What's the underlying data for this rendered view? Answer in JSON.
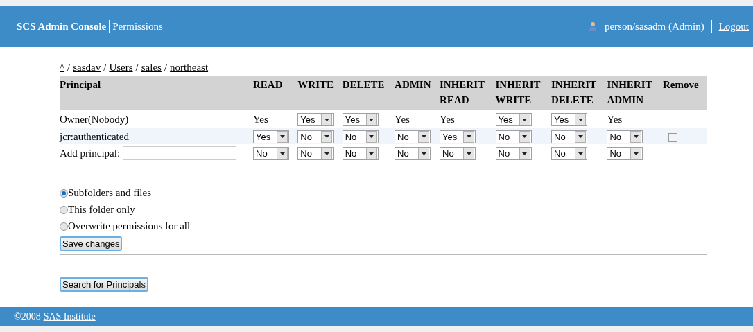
{
  "header": {
    "title": "SCS Admin Console",
    "section": "Permissions",
    "user": "person/sasadm (Admin)",
    "logout": "Logout"
  },
  "breadcrumb": [
    {
      "kind": "link",
      "text": "^"
    },
    {
      "kind": "separator",
      "text": "/"
    },
    {
      "kind": "link",
      "text": "sasdav"
    },
    {
      "kind": "separator",
      "text": "/"
    },
    {
      "kind": "link",
      "text": "Users"
    },
    {
      "kind": "separator",
      "text": "/"
    },
    {
      "kind": "link",
      "text": "sales"
    },
    {
      "kind": "separator",
      "text": "/"
    },
    {
      "kind": "link",
      "text": "northeast"
    }
  ],
  "table": {
    "columns": [
      {
        "lines": [
          "Principal"
        ]
      },
      {
        "lines": [
          "READ"
        ]
      },
      {
        "lines": [
          "WRITE"
        ]
      },
      {
        "lines": [
          "DELETE"
        ]
      },
      {
        "lines": [
          "ADMIN"
        ]
      },
      {
        "lines": [
          "INHERIT",
          "READ"
        ]
      },
      {
        "lines": [
          "INHERIT",
          "WRITE"
        ]
      },
      {
        "lines": [
          "INHERIT",
          "DELETE"
        ]
      },
      {
        "lines": [
          "INHERIT",
          "ADMIN"
        ]
      },
      {
        "lines": [
          "Remove"
        ]
      }
    ],
    "rows": [
      {
        "cells": [
          {
            "kind": "principal",
            "value": "Owner(Nobody)"
          },
          {
            "kind": "text",
            "value": "Yes"
          },
          {
            "kind": "select",
            "value": "Yes"
          },
          {
            "kind": "select",
            "value": "Yes"
          },
          {
            "kind": "text",
            "value": "Yes"
          },
          {
            "kind": "text",
            "value": "Yes"
          },
          {
            "kind": "select",
            "value": "Yes"
          },
          {
            "kind": "select",
            "value": "Yes"
          },
          {
            "kind": "text",
            "value": "Yes"
          }
        ]
      },
      {
        "cells": [
          {
            "kind": "principal",
            "value": "jcr:authenticated"
          },
          {
            "kind": "select",
            "value": "Yes"
          },
          {
            "kind": "select",
            "value": "No"
          },
          {
            "kind": "select",
            "value": "No"
          },
          {
            "kind": "select",
            "value": "No"
          },
          {
            "kind": "select",
            "value": "Yes"
          },
          {
            "kind": "select",
            "value": "No"
          },
          {
            "kind": "select",
            "value": "No"
          },
          {
            "kind": "select",
            "value": "No"
          },
          {
            "kind": "checkbox",
            "checked": false
          }
        ]
      },
      {
        "cells": [
          {
            "kind": "add",
            "value": "Add principal:"
          },
          {
            "kind": "select",
            "value": "No"
          },
          {
            "kind": "select",
            "value": "No"
          },
          {
            "kind": "select",
            "value": "No"
          },
          {
            "kind": "select",
            "value": "No"
          },
          {
            "kind": "select",
            "value": "No"
          },
          {
            "kind": "select",
            "value": "No"
          },
          {
            "kind": "select",
            "value": "No"
          },
          {
            "kind": "select",
            "value": "No"
          }
        ]
      }
    ]
  },
  "scope": [
    {
      "label": "Subfolders and files",
      "selected": true
    },
    {
      "label": "This folder only",
      "selected": false
    },
    {
      "label": "Overwrite permissions for all",
      "selected": false
    }
  ],
  "save_button": "Save changes",
  "search_button": "Search for Principals",
  "footer": {
    "copyright": "©2008",
    "link": "SAS Institute"
  }
}
